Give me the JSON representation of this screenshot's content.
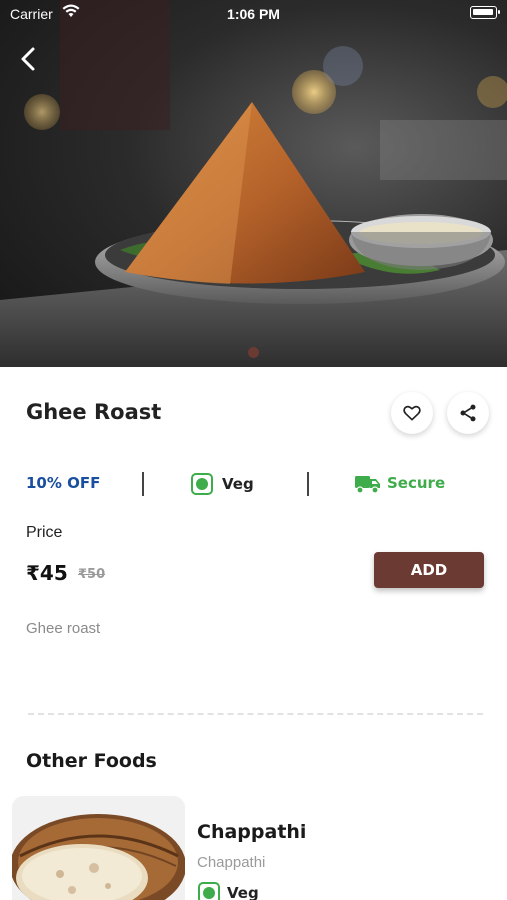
{
  "status_bar": {
    "carrier": "Carrier",
    "time": "1:06 PM"
  },
  "hero": {
    "slide_count": 1,
    "active_slide": 1
  },
  "product": {
    "title": "Ghee Roast",
    "discount": "10% OFF",
    "veg_label": "Veg",
    "secure_label": "Secure",
    "price_label": "Price",
    "price": "₹45",
    "original_price": "₹50",
    "add_label": "ADD",
    "description": "Ghee roast"
  },
  "other_foods": {
    "title": "Other Foods",
    "items": [
      {
        "name": "Chappathi",
        "description": "Chappathi",
        "veg_label": "Veg"
      }
    ]
  },
  "colors": {
    "brand": "#6b3a32",
    "discount_blue": "#1a4fa0",
    "veg_green": "#3eac4a"
  },
  "icons": {
    "back": "chevron-left-icon",
    "favorite": "heart-icon",
    "share": "share-icon",
    "secure": "truck-icon"
  }
}
